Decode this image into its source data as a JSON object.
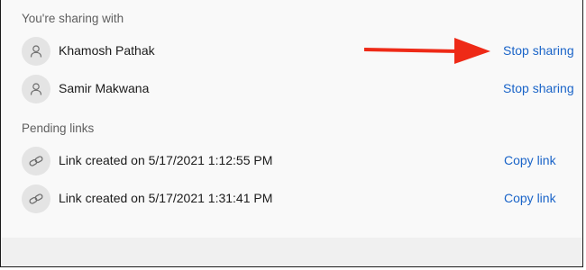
{
  "sharing": {
    "heading": "You're sharing with",
    "people": [
      {
        "name": "Khamosh Pathak",
        "action_label": "Stop sharing"
      },
      {
        "name": "Samir Makwana",
        "action_label": "Stop sharing"
      }
    ]
  },
  "pending": {
    "heading": "Pending links",
    "links": [
      {
        "label": "Link created on 5/17/2021 1:12:55 PM",
        "action_label": "Copy link"
      },
      {
        "label": "Link created on 5/17/2021 1:31:41 PM",
        "action_label": "Copy link"
      }
    ]
  },
  "annotation": {
    "arrow_color": "#ee2a17"
  },
  "colors": {
    "link": "#1a64c8",
    "avatar_bg": "#e4e4e4",
    "panel_bg": "#f9f9f9"
  },
  "icons": {
    "person": "person-icon",
    "link": "link-icon",
    "arrow": "red-arrow-icon"
  }
}
